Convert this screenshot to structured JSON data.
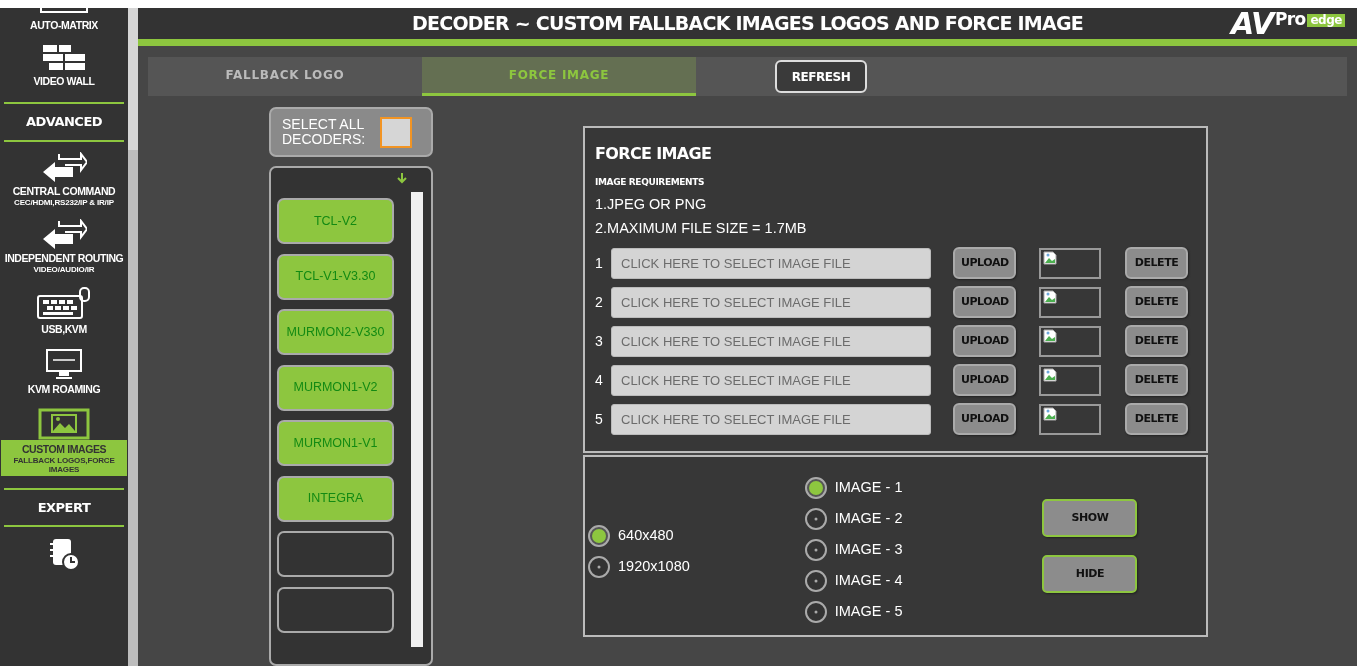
{
  "sidebar": {
    "items": [
      {
        "kind": "item",
        "label": "AUTO-MATRIX",
        "selected": false
      },
      {
        "kind": "item",
        "label": "VIDEO WALL",
        "selected": false
      },
      {
        "kind": "section",
        "label": "ADVANCED"
      },
      {
        "kind": "item",
        "label": "CENTRAL COMMAND",
        "sublabel": "CEC/HDMI,RS232/IP & IR/IP",
        "selected": false
      },
      {
        "kind": "item",
        "label": "INDEPENDENT ROUTING",
        "sublabel": "VIDEO/AUDIO/IR",
        "selected": false
      },
      {
        "kind": "item",
        "label": "USB,KVM",
        "selected": false
      },
      {
        "kind": "item",
        "label": "KVM ROAMING",
        "selected": false
      },
      {
        "kind": "item",
        "label": "CUSTOM IMAGES",
        "sublabel": "FALLBACK LOGOS,FORCE IMAGES",
        "selected": true
      },
      {
        "kind": "section",
        "label": "EXPERT"
      },
      {
        "kind": "item",
        "selected": false
      }
    ]
  },
  "header": {
    "title": "DECODER ~ CUSTOM FALLBACK IMAGES LOGOS AND FORCE IMAGE",
    "logo": {
      "mark": "AV",
      "pro": "Pro",
      "edge": "edge"
    }
  },
  "tabs": [
    {
      "label": "FALLBACK LOGO",
      "selected": false
    },
    {
      "label": "FORCE IMAGE",
      "selected": true
    }
  ],
  "refresh_button": "REFRESH",
  "select_all": {
    "label": "SELECT ALL DECODERS:",
    "checked": false
  },
  "decoders": [
    {
      "kind": "decoder",
      "label": "TCL-V2",
      "selected": true
    },
    {
      "kind": "decoder",
      "label": "TCL-V1-V3.30",
      "selected": true
    },
    {
      "kind": "decoder",
      "label": "MURMON2-V330",
      "selected": true
    },
    {
      "kind": "decoder",
      "label": "MURMON1-V2",
      "selected": true
    },
    {
      "kind": "decoder",
      "label": "MURMON1-V1",
      "selected": true
    },
    {
      "kind": "decoder",
      "label": "INTEGRA",
      "selected": true
    },
    {
      "kind": "empty"
    },
    {
      "kind": "empty"
    }
  ],
  "force_image": {
    "title": "FORCE IMAGE",
    "requirements_title": "IMAGE REQUIREMENTS",
    "requirements": [
      "1.JPEG OR PNG",
      "2.MAXIMUM FILE SIZE = 1.7MB"
    ],
    "files": [
      {
        "number": "1",
        "placeholder": "CLICK HERE TO SELECT IMAGE FILE",
        "upload": "UPLOAD",
        "delete": "DELETE"
      },
      {
        "number": "2",
        "placeholder": "CLICK HERE TO SELECT IMAGE FILE",
        "upload": "UPLOAD",
        "delete": "DELETE"
      },
      {
        "number": "3",
        "placeholder": "CLICK HERE TO SELECT IMAGE FILE",
        "upload": "UPLOAD",
        "delete": "DELETE"
      },
      {
        "number": "4",
        "placeholder": "CLICK HERE TO SELECT IMAGE FILE",
        "upload": "UPLOAD",
        "delete": "DELETE"
      },
      {
        "number": "5",
        "placeholder": "CLICK HERE TO SELECT IMAGE FILE",
        "upload": "UPLOAD",
        "delete": "DELETE"
      }
    ]
  },
  "resolutions": [
    {
      "label": "640x480",
      "selected": true
    },
    {
      "label": "1920x1080",
      "selected": false
    }
  ],
  "images": [
    {
      "label": "IMAGE - 1",
      "selected": true
    },
    {
      "label": "IMAGE - 2",
      "selected": false
    },
    {
      "label": "IMAGE - 3",
      "selected": false
    },
    {
      "label": "IMAGE - 4",
      "selected": false
    },
    {
      "label": "IMAGE - 5",
      "selected": false
    }
  ],
  "buttons": [
    "SHOW",
    "HIDE"
  ]
}
